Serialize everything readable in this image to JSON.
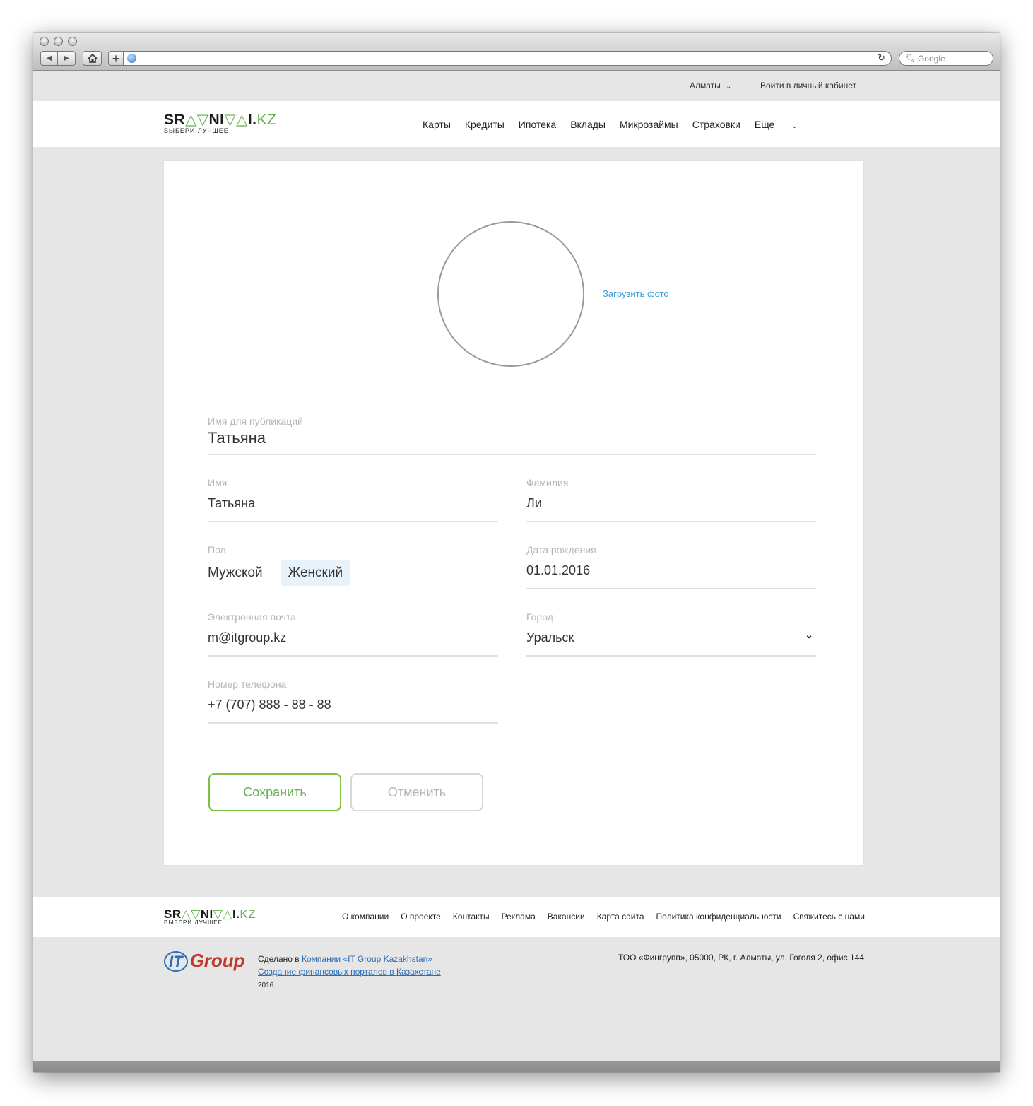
{
  "browser": {
    "search_placeholder": "Google"
  },
  "topbar": {
    "city": "Алматы",
    "login": "Войти в личный кабинет"
  },
  "logo": {
    "main_black_1": "SR",
    "main_green_1": "△▽",
    "main_black_2": "NI",
    "main_green_2": "▽△",
    "main_black_3": "I.",
    "main_green_3": "KZ",
    "tagline": "ВЫБЕРИ ЛУЧШЕЕ"
  },
  "nav": {
    "items": [
      "Карты",
      "Кредиты",
      "Ипотека",
      "Вклады",
      "Микрозаймы",
      "Страховки",
      "Еще"
    ]
  },
  "profile": {
    "upload_photo": "Загрузить фото",
    "pub_name_label": "Имя для публикаций",
    "pub_name_value": "Татьяна",
    "first_name_label": "Имя",
    "first_name_value": "Татьяна",
    "last_name_label": "Фамилия",
    "last_name_value": "Ли",
    "gender_label": "Пол",
    "gender_options": [
      "Мужской",
      "Женский"
    ],
    "gender_selected": "Женский",
    "dob_label": "Дата рождения",
    "dob_value": "01.01.2016",
    "email_label": "Электронная почта",
    "email_value": "m@itgroup.kz",
    "city_label": "Город",
    "city_value": "Уральск",
    "phone_label": "Номер телефона",
    "phone_value": "+7 (707) 888 - 88 - 88",
    "save": "Сохранить",
    "cancel": "Отменить"
  },
  "footer": {
    "links": [
      "О компании",
      "О проекте",
      "Контакты",
      "Реклама",
      "Вакансии",
      "Карта сайта",
      "Политика конфиденциальности",
      "Свяжитесь с нами"
    ],
    "it_logo_it": "IT",
    "it_logo_group": "Group",
    "made_prefix": "Сделано в",
    "made_link": "Компании «IT Group Kazakhstan»",
    "made_sub_link": "Создание финансовых порталов в Казахстане",
    "year": "2016",
    "address": "ТОО «Фингрупп», 05000, РК, г. Алматы, ул. Гоголя 2, офис 144"
  },
  "colors": {
    "brand_green": "#62b04a",
    "link_blue": "#3a9bd8",
    "selected_bg": "#e8f2fb"
  }
}
